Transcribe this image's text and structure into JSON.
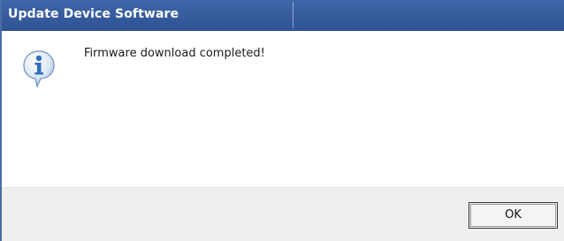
{
  "window": {
    "title": "Update Device Software"
  },
  "message": {
    "icon": "info-icon",
    "text": "Firmware download completed!"
  },
  "buttons": {
    "ok_label": "OK"
  },
  "colors": {
    "titlebar": "#3a60a2",
    "icon_blue": "#2f6fc0",
    "footer": "#efefef"
  }
}
